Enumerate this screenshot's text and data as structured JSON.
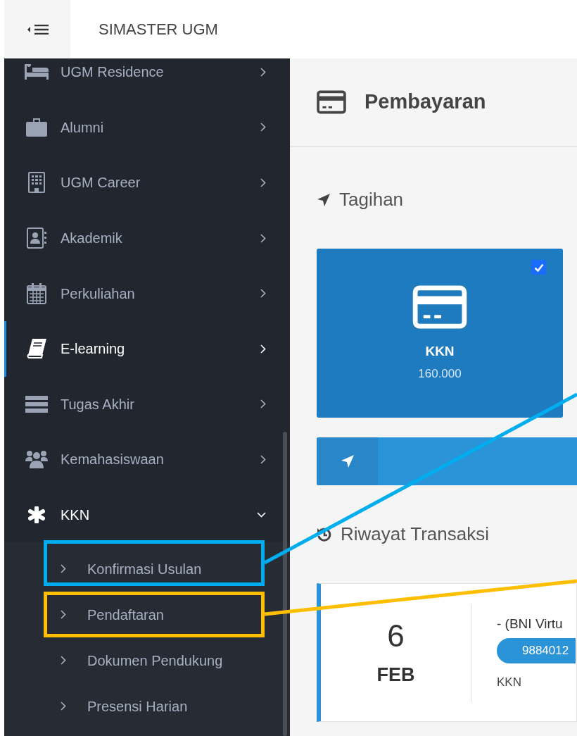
{
  "header": {
    "title": "SIMASTER UGM"
  },
  "sidebar": {
    "items": [
      {
        "label": "UGM Residence",
        "selected": false,
        "expanded": false
      },
      {
        "label": "Alumni",
        "selected": false,
        "expanded": false
      },
      {
        "label": "UGM Career",
        "selected": false,
        "expanded": false
      },
      {
        "label": "Akademik",
        "selected": false,
        "expanded": false
      },
      {
        "label": "Perkuliahan",
        "selected": false,
        "expanded": false
      },
      {
        "label": "E-learning",
        "selected": true,
        "expanded": false
      },
      {
        "label": "Tugas Akhir",
        "selected": false,
        "expanded": false
      },
      {
        "label": "Kemahasiswaan",
        "selected": false,
        "expanded": false
      },
      {
        "label": "KKN",
        "selected": false,
        "expanded": true,
        "children": [
          {
            "label": "Konfirmasi Usulan"
          },
          {
            "label": "Pendaftaran"
          },
          {
            "label": "Dokumen Pendukung"
          },
          {
            "label": "Presensi Harian"
          }
        ]
      }
    ]
  },
  "page": {
    "title": "Pembayaran",
    "bills": {
      "heading": "Tagihan",
      "items": [
        {
          "name": "KKN",
          "amount": "160.000",
          "checked": true
        }
      ]
    },
    "history": {
      "heading": "Riwayat Transaksi",
      "items": [
        {
          "day": "6",
          "month": "FEB",
          "method": "- (BNI Virtu",
          "code": "9884012",
          "category": "KKN"
        }
      ]
    }
  },
  "annotations": [
    {
      "color": "#00aeef"
    },
    {
      "color": "#ffbf00"
    }
  ]
}
